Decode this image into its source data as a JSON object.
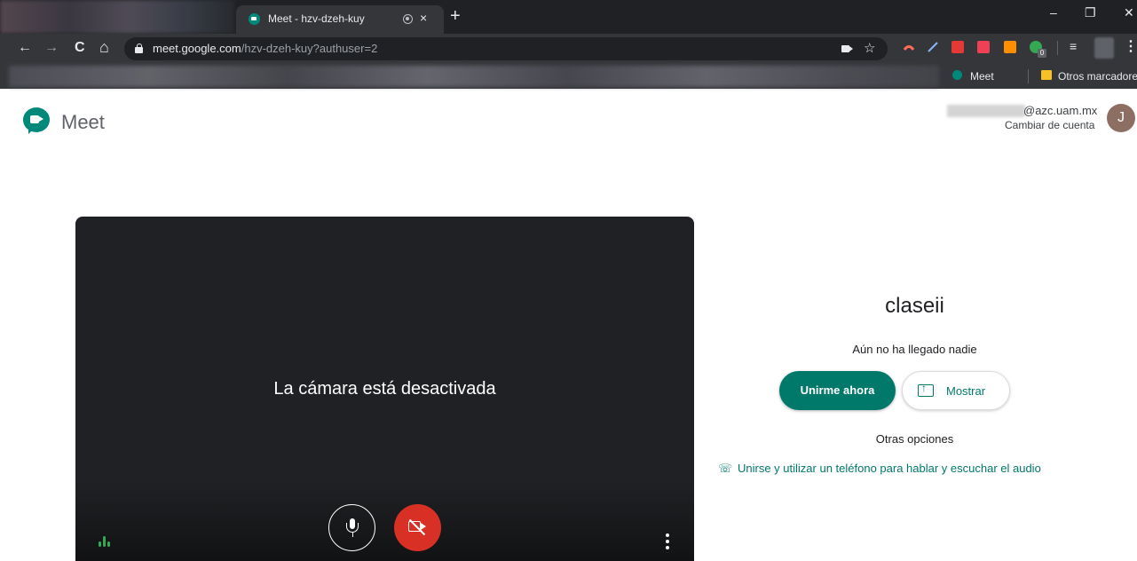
{
  "browser": {
    "tab_title": "Meet - hzv-dzeh-kuy",
    "tab_close": "×",
    "new_tab": "+",
    "window_controls": {
      "minimize": "–",
      "restore": "❐",
      "close": "✕"
    },
    "nav": {
      "back": "←",
      "forward": "→",
      "reload": "C",
      "home": "⌂"
    },
    "url_host": "meet.google.com",
    "url_path": "/hzv-dzeh-kuy?authuser=2",
    "bookmark_star": "☆",
    "menu": "⋮",
    "bookmarks": [
      {
        "label": "Meet",
        "icon": "meet-icon"
      },
      {
        "label": "Otros marcadores",
        "icon": "folder-icon"
      }
    ],
    "extensions": [
      {
        "name": "extension-red-icon",
        "color": "#ff6d5a"
      },
      {
        "name": "pen-icon",
        "color": "#8ab4f8"
      },
      {
        "name": "pdf-icon",
        "color": "#e53935"
      },
      {
        "name": "pocket-icon",
        "color": "#ef4056"
      },
      {
        "name": "shop-icon",
        "color": "#ff8f00"
      },
      {
        "name": "check-icon",
        "color": "#34a853"
      }
    ],
    "extension_badge": "0",
    "reading_list": "≡"
  },
  "header": {
    "brand": "Meet",
    "account_email": "@azc.uam.mx",
    "switch_account": "Cambiar de cuenta",
    "avatar_letter": "J"
  },
  "preview": {
    "camera_off_text": "La cámara está desactivada"
  },
  "join_panel": {
    "meeting_name": "claseii",
    "status": "Aún no ha llegado nadie",
    "join_button": "Unirme ahora",
    "present_button": "Mostrar",
    "other_options": "Otras opciones",
    "phone_option": "Unirse y utilizar un teléfono para hablar y escuchar el audio"
  },
  "colors": {
    "accent": "#00796b",
    "camera_off": "#d93025",
    "preview_bg": "#202124",
    "avatar": "#8d6e63"
  }
}
